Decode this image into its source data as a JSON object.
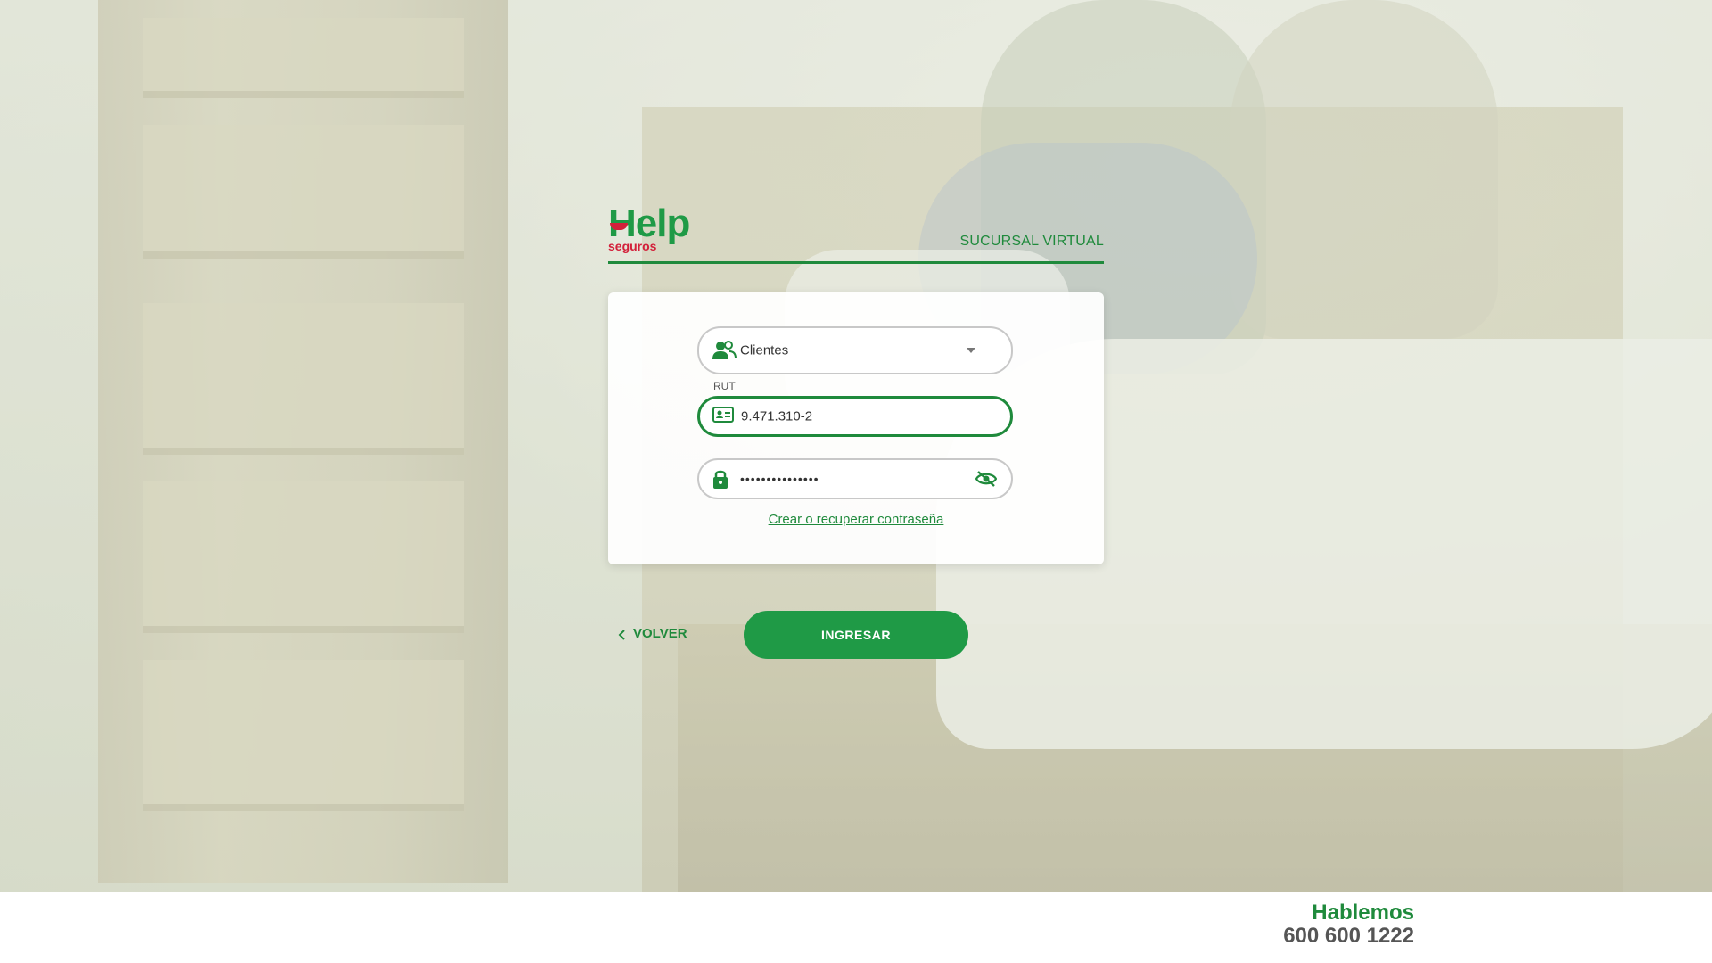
{
  "brand": {
    "logo_word": "Help",
    "logo_sub": "seguros",
    "section_title": "SUCURSAL VIRTUAL",
    "primary_color": "#1f9a46",
    "accent_color": "#d3203a"
  },
  "login": {
    "user_type": {
      "selected": "Clientes",
      "icon": "users-icon"
    },
    "rut": {
      "label": "RUT",
      "value": "9.471.310-2",
      "icon": "id-card-icon"
    },
    "password": {
      "value": "•••••••••••••••",
      "icon": "lock-icon",
      "toggle_icon": "eye-off-icon"
    },
    "forgot_link": "Crear o recuperar contraseña"
  },
  "actions": {
    "back_label": "VOLVER",
    "submit_label": "INGRESAR"
  },
  "footer": {
    "contact_title": "Hablemos",
    "contact_phone": "600 600 1222"
  }
}
